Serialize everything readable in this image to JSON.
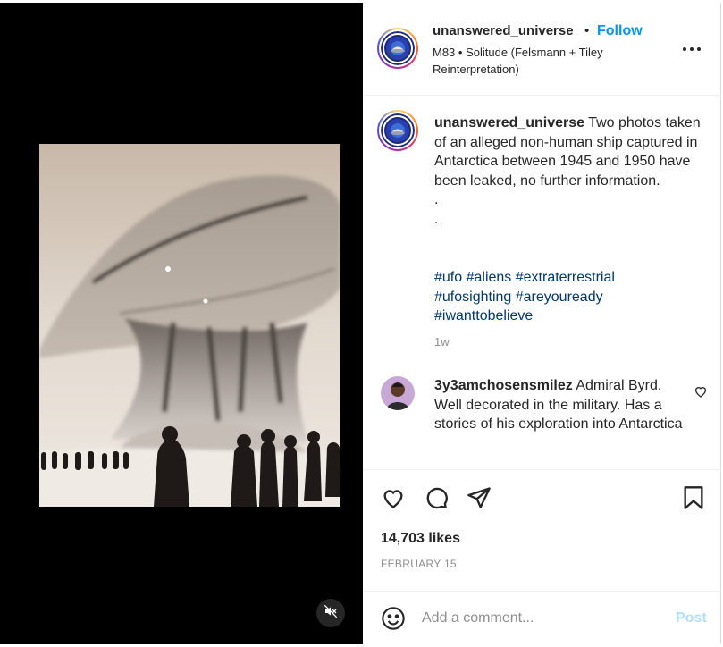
{
  "post": {
    "username": "unanswered_universe",
    "separator": "•",
    "follow_label": "Follow",
    "audio": "M83 • Solitude (Felsmann + Tiley Reinterpretation)"
  },
  "caption": {
    "username": "unanswered_universe",
    "text": "Two photos taken of an alleged non-human ship captured in Antarctica between 1945 and 1950 have been leaked, no further information.",
    "dots": [
      ".",
      "."
    ],
    "hashtags": [
      "#ufo",
      "#aliens",
      "#extraterrestrial",
      "#ufosighting",
      "#areyouready",
      "#iwanttobelieve"
    ],
    "age": "1w"
  },
  "comments": [
    {
      "username": "3y3amchosensmilez",
      "text": "Admiral Byrd. Well decorated in the military. Has a stories of his exploration into Antarctica"
    }
  ],
  "stats": {
    "likes": "14,703 likes",
    "date": "FEBRUARY 15"
  },
  "composer": {
    "placeholder": "Add a comment...",
    "post_label": "Post"
  },
  "icons": {
    "mute": "speaker-muted-icon",
    "more": "more-options-icon",
    "like": "heart-icon",
    "comment": "comment-bubble-icon",
    "share": "paper-plane-icon",
    "save": "bookmark-icon",
    "emoji": "emoji-smile-icon"
  },
  "colors": {
    "accent": "#0095f6",
    "hashtag": "#00376b",
    "muted_text": "#8e8e8e",
    "post_disabled": "#b2dffc"
  }
}
